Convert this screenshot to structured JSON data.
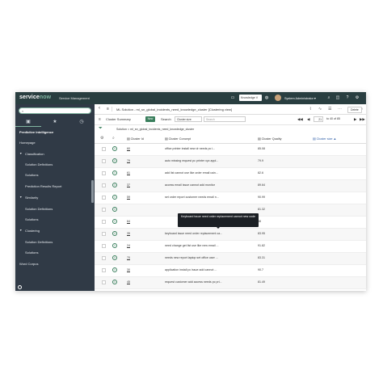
{
  "banner": {
    "logo_service": "service",
    "logo_now": "now",
    "product": "Service Management",
    "kb_select": "Knowledge V",
    "user": "System Administrator ▾"
  },
  "nav": {
    "filter_placeholder": "Filter navigator",
    "items": [
      {
        "label": "Predictive Intelligence",
        "kind": "hdr"
      },
      {
        "label": "Homepage",
        "kind": "sect"
      },
      {
        "label": "Classification",
        "kind": "caret"
      },
      {
        "label": "Solution Definitions",
        "kind": "sub"
      },
      {
        "label": "Solutions",
        "kind": "sub"
      },
      {
        "label": "Prediction Results Report",
        "kind": "sub"
      },
      {
        "label": "Similarity",
        "kind": "caret"
      },
      {
        "label": "Solution Definitions",
        "kind": "sub"
      },
      {
        "label": "Solutions",
        "kind": "sub"
      },
      {
        "label": "Clustering",
        "kind": "caret"
      },
      {
        "label": "Solution Definitions",
        "kind": "sub"
      },
      {
        "label": "Solutions",
        "kind": "sub"
      },
      {
        "label": "Word Corpus",
        "kind": "sect"
      }
    ]
  },
  "titlebar": {
    "title": "ML Solution - ml_sn_global_incidents_need_knowledge_cluster [Clustering view]",
    "delete_label": "Delete"
  },
  "toolbar": {
    "cluster_summary": "Cluster Summary",
    "new_label": "New",
    "search_label": "Search",
    "search_field": "Cluster size",
    "search_placeholder": "Search",
    "page_value": "21",
    "page_text": "to 40 of 85"
  },
  "breadcrumb": "Solution = ml_sn_global_incidents_need_knowledge_cluster",
  "columns": {
    "cluster_id": "Cluster Id",
    "cluster_concept": "Cluster Concept",
    "cluster_quality": "Cluster Quality",
    "cluster_size": "Cluster size ▲"
  },
  "rows": [
    {
      "id": "60",
      "concept": "office printer install new dr needs pc i...",
      "quality": "85.08"
    },
    {
      "id": "79",
      "concept": "auto missing request pc printer xyz appl...",
      "quality": "79.9"
    },
    {
      "id": "61",
      "concept": "add list cannot use like order email usin...",
      "quality": "82.6"
    },
    {
      "id": "37",
      "concept": "access email issue cannot add monitor",
      "quality": "89.64"
    },
    {
      "id": "59",
      "concept": "set order report customer needs email n...",
      "quality": "90.99"
    },
    {
      "id": "",
      "concept": "",
      "quality": "81.32"
    },
    {
      "id": "64",
      "concept": "",
      "quality": "88"
    },
    {
      "id": "35",
      "concept": "keyboard issue need order replacement ca...",
      "quality": "83.95"
    },
    {
      "id": "24",
      "concept": "need change get list use like new email ...",
      "quality": "91.82"
    },
    {
      "id": "70",
      "concept": "needs new report laptop set office user ...",
      "quality": "83.31"
    },
    {
      "id": "30",
      "concept": "application install pc issue add cannot ...",
      "quality": "90.7"
    },
    {
      "id": "45",
      "concept": "request customer add access needs pc pri...",
      "quality": "81.49"
    }
  ],
  "tooltip": "Keyboard issue need order replacement cannot new code",
  "icons": {
    "back": "chevron-left-icon",
    "paperclip": "paperclip-icon",
    "activity": "activity-icon",
    "settings": "sliders-icon",
    "more": "more-icon",
    "up": "arrow-up-icon",
    "down": "arrow-down-icon",
    "search": "search-icon",
    "chat": "chat-icon",
    "help": "help-icon",
    "gear": "gear-icon"
  },
  "colors": {
    "banner": "#293e40",
    "nav": "#303a46",
    "accent": "#81b5a1",
    "new_button": "#3a7f5d"
  }
}
